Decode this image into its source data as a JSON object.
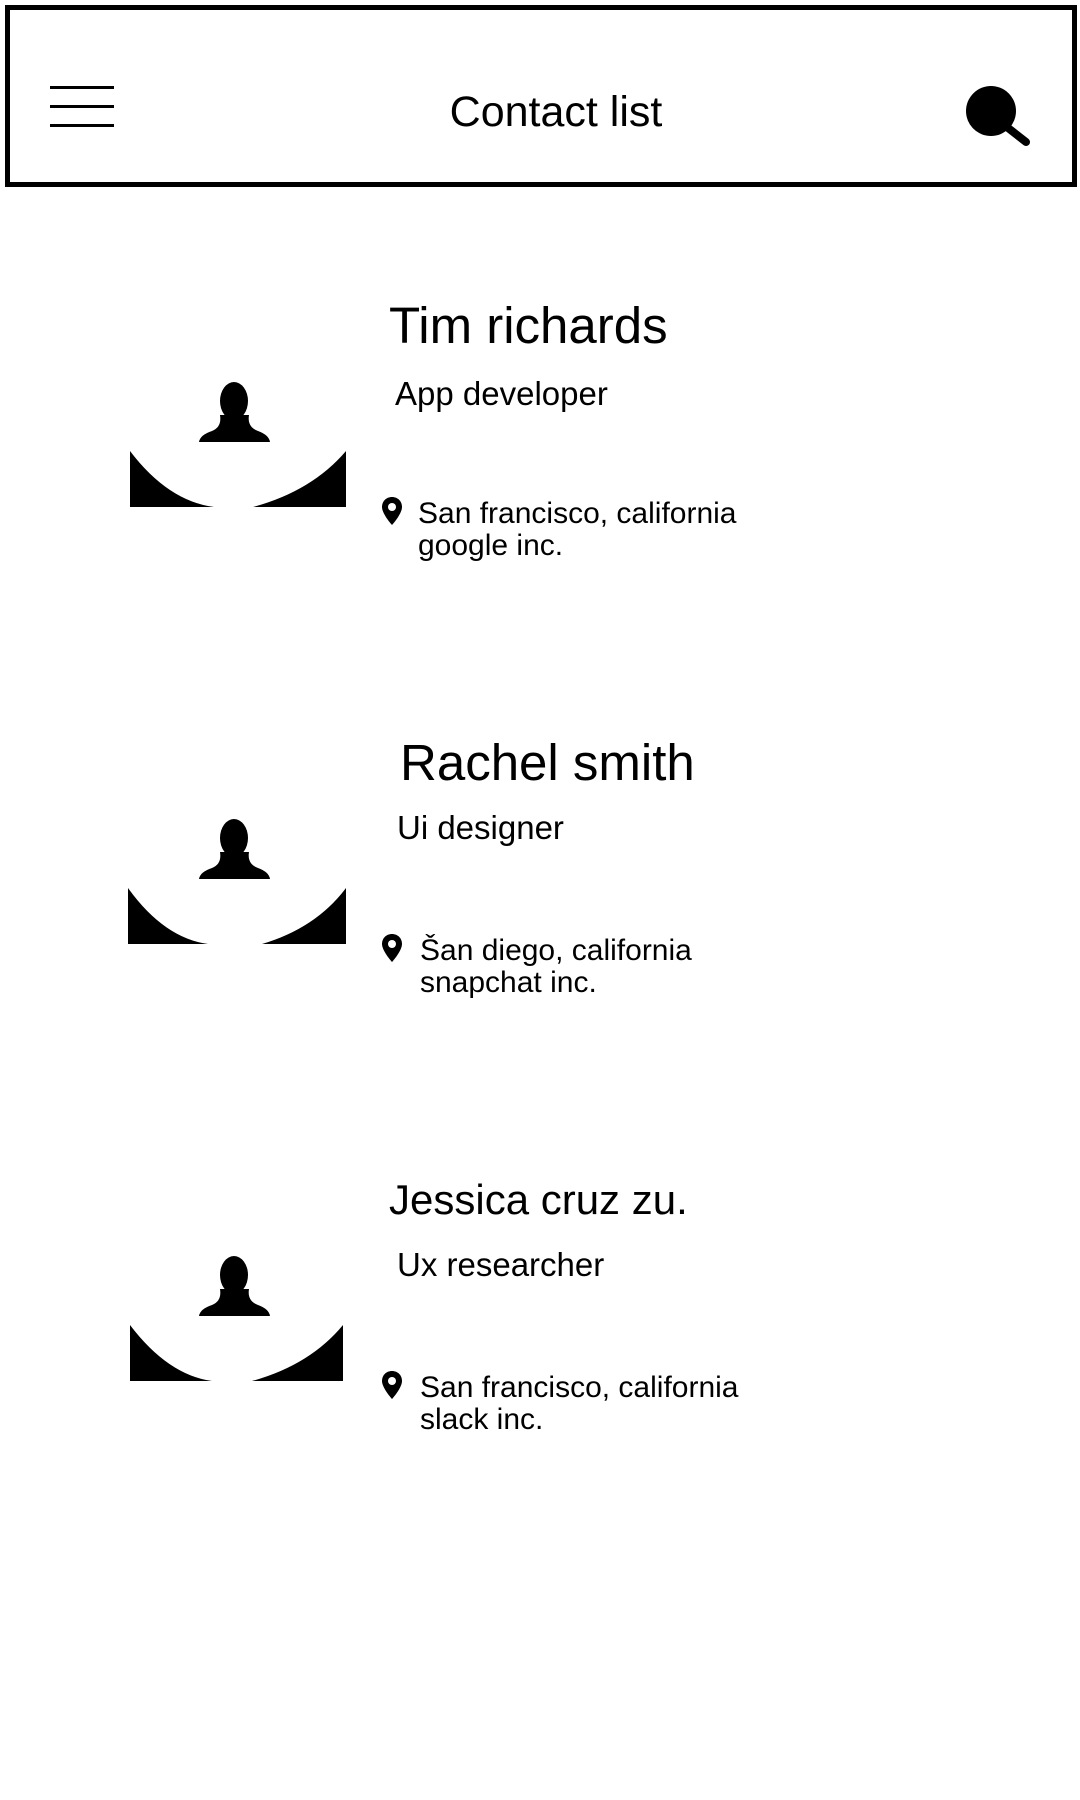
{
  "header": {
    "title": "Contact list",
    "menu_icon": "hamburger-menu-icon",
    "search_icon": "search-icon"
  },
  "contacts": [
    {
      "name": "Tim richards",
      "role": "App developer",
      "location": "San francisco, california",
      "company": "google inc.",
      "avatar_icon": "person-avatar-icon",
      "location_icon": "map-pin-icon"
    },
    {
      "name": "Rachel smith",
      "role": "Ui designer",
      "location": "Šan diego, california",
      "company": "snapchat inc.",
      "avatar_icon": "person-avatar-icon",
      "location_icon": "map-pin-icon"
    },
    {
      "name": "Jessica cruz zu.",
      "role": "Ux researcher",
      "location": "San francisco, california",
      "company": "slack inc.",
      "avatar_icon": "person-avatar-icon",
      "location_icon": "map-pin-icon"
    }
  ],
  "colors": {
    "background": "#ffffff",
    "foreground": "#000000"
  }
}
